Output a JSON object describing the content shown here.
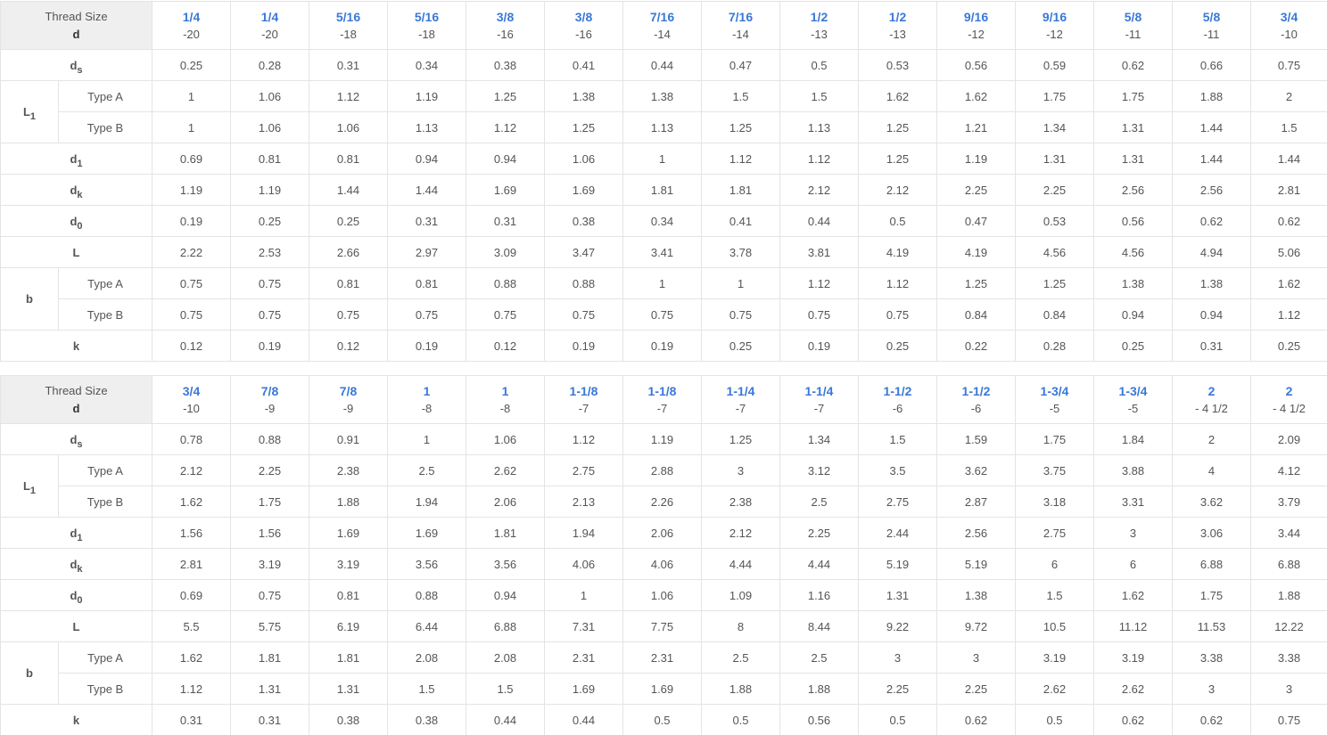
{
  "tables": [
    {
      "header": {
        "corner_line1": "Thread Size",
        "corner_line2": "d",
        "sizes": [
          "1/4",
          "1/4",
          "5/16",
          "5/16",
          "3/8",
          "3/8",
          "7/16",
          "7/16",
          "1/2",
          "1/2",
          "9/16",
          "9/16",
          "5/8",
          "5/8",
          "3/4"
        ],
        "pitches": [
          "-20",
          "-20",
          "-18",
          "-18",
          "-16",
          "-16",
          "-14",
          "-14",
          "-13",
          "-13",
          "-12",
          "-12",
          "-11",
          "-11",
          "-10"
        ]
      },
      "rows": [
        {
          "group": "d",
          "group_sub": "s",
          "values": [
            "0.25",
            "0.28",
            "0.31",
            "0.34",
            "0.38",
            "0.41",
            "0.44",
            "0.47",
            "0.5",
            "0.53",
            "0.56",
            "0.59",
            "0.62",
            "0.66",
            "0.75"
          ]
        },
        {
          "group": "L",
          "group_sub": "1",
          "type": "Type A",
          "values": [
            "1",
            "1.06",
            "1.12",
            "1.19",
            "1.25",
            "1.38",
            "1.38",
            "1.5",
            "1.5",
            "1.62",
            "1.62",
            "1.75",
            "1.75",
            "1.88",
            "2"
          ]
        },
        {
          "type": "Type B",
          "values": [
            "1",
            "1.06",
            "1.06",
            "1.13",
            "1.12",
            "1.25",
            "1.13",
            "1.25",
            "1.13",
            "1.25",
            "1.21",
            "1.34",
            "1.31",
            "1.44",
            "1.5"
          ]
        },
        {
          "group": "d",
          "group_sub": "1",
          "values": [
            "0.69",
            "0.81",
            "0.81",
            "0.94",
            "0.94",
            "1.06",
            "1",
            "1.12",
            "1.12",
            "1.25",
            "1.19",
            "1.31",
            "1.31",
            "1.44",
            "1.44"
          ]
        },
        {
          "group": "d",
          "group_sub": "k",
          "values": [
            "1.19",
            "1.19",
            "1.44",
            "1.44",
            "1.69",
            "1.69",
            "1.81",
            "1.81",
            "2.12",
            "2.12",
            "2.25",
            "2.25",
            "2.56",
            "2.56",
            "2.81"
          ]
        },
        {
          "group": "d",
          "group_sub": "0",
          "values": [
            "0.19",
            "0.25",
            "0.25",
            "0.31",
            "0.31",
            "0.38",
            "0.34",
            "0.41",
            "0.44",
            "0.5",
            "0.47",
            "0.53",
            "0.56",
            "0.62",
            "0.62"
          ]
        },
        {
          "group": "L",
          "group_sub": "",
          "values": [
            "2.22",
            "2.53",
            "2.66",
            "2.97",
            "3.09",
            "3.47",
            "3.41",
            "3.78",
            "3.81",
            "4.19",
            "4.19",
            "4.56",
            "4.56",
            "4.94",
            "5.06"
          ]
        },
        {
          "group": "b",
          "group_sub": "",
          "type": "Type A",
          "values": [
            "0.75",
            "0.75",
            "0.81",
            "0.81",
            "0.88",
            "0.88",
            "1",
            "1",
            "1.12",
            "1.12",
            "1.25",
            "1.25",
            "1.38",
            "1.38",
            "1.62"
          ]
        },
        {
          "type": "Type B",
          "values": [
            "0.75",
            "0.75",
            "0.75",
            "0.75",
            "0.75",
            "0.75",
            "0.75",
            "0.75",
            "0.75",
            "0.75",
            "0.84",
            "0.84",
            "0.94",
            "0.94",
            "1.12"
          ]
        },
        {
          "group": "k",
          "group_sub": "",
          "values": [
            "0.12",
            "0.19",
            "0.12",
            "0.19",
            "0.12",
            "0.19",
            "0.19",
            "0.25",
            "0.19",
            "0.25",
            "0.22",
            "0.28",
            "0.25",
            "0.31",
            "0.25"
          ]
        }
      ]
    },
    {
      "header": {
        "corner_line1": "Thread Size",
        "corner_line2": "d",
        "sizes": [
          "3/4",
          "7/8",
          "7/8",
          "1",
          "1",
          "1-1/8",
          "1-1/8",
          "1-1/4",
          "1-1/4",
          "1-1/2",
          "1-1/2",
          "1-3/4",
          "1-3/4",
          "2",
          "2"
        ],
        "pitches": [
          "-10",
          "-9",
          "-9",
          "-8",
          "-8",
          "-7",
          "-7",
          "-7",
          "-7",
          "-6",
          "-6",
          "-5",
          "-5",
          "- 4 1/2",
          "- 4 1/2"
        ]
      },
      "rows": [
        {
          "group": "d",
          "group_sub": "s",
          "values": [
            "0.78",
            "0.88",
            "0.91",
            "1",
            "1.06",
            "1.12",
            "1.19",
            "1.25",
            "1.34",
            "1.5",
            "1.59",
            "1.75",
            "1.84",
            "2",
            "2.09"
          ]
        },
        {
          "group": "L",
          "group_sub": "1",
          "type": "Type A",
          "values": [
            "2.12",
            "2.25",
            "2.38",
            "2.5",
            "2.62",
            "2.75",
            "2.88",
            "3",
            "3.12",
            "3.5",
            "3.62",
            "3.75",
            "3.88",
            "4",
            "4.12"
          ]
        },
        {
          "type": "Type B",
          "values": [
            "1.62",
            "1.75",
            "1.88",
            "1.94",
            "2.06",
            "2.13",
            "2.26",
            "2.38",
            "2.5",
            "2.75",
            "2.87",
            "3.18",
            "3.31",
            "3.62",
            "3.79"
          ]
        },
        {
          "group": "d",
          "group_sub": "1",
          "values": [
            "1.56",
            "1.56",
            "1.69",
            "1.69",
            "1.81",
            "1.94",
            "2.06",
            "2.12",
            "2.25",
            "2.44",
            "2.56",
            "2.75",
            "3",
            "3.06",
            "3.44"
          ]
        },
        {
          "group": "d",
          "group_sub": "k",
          "values": [
            "2.81",
            "3.19",
            "3.19",
            "3.56",
            "3.56",
            "4.06",
            "4.06",
            "4.44",
            "4.44",
            "5.19",
            "5.19",
            "6",
            "6",
            "6.88",
            "6.88"
          ]
        },
        {
          "group": "d",
          "group_sub": "0",
          "values": [
            "0.69",
            "0.75",
            "0.81",
            "0.88",
            "0.94",
            "1",
            "1.06",
            "1.09",
            "1.16",
            "1.31",
            "1.38",
            "1.5",
            "1.62",
            "1.75",
            "1.88"
          ]
        },
        {
          "group": "L",
          "group_sub": "",
          "values": [
            "5.5",
            "5.75",
            "6.19",
            "6.44",
            "6.88",
            "7.31",
            "7.75",
            "8",
            "8.44",
            "9.22",
            "9.72",
            "10.5",
            "11.12",
            "11.53",
            "12.22"
          ]
        },
        {
          "group": "b",
          "group_sub": "",
          "type": "Type A",
          "values": [
            "1.62",
            "1.81",
            "1.81",
            "2.08",
            "2.08",
            "2.31",
            "2.31",
            "2.5",
            "2.5",
            "3",
            "3",
            "3.19",
            "3.19",
            "3.38",
            "3.38"
          ]
        },
        {
          "type": "Type B",
          "values": [
            "1.12",
            "1.31",
            "1.31",
            "1.5",
            "1.5",
            "1.69",
            "1.69",
            "1.88",
            "1.88",
            "2.25",
            "2.25",
            "2.62",
            "2.62",
            "3",
            "3"
          ]
        },
        {
          "group": "k",
          "group_sub": "",
          "values": [
            "0.31",
            "0.31",
            "0.38",
            "0.38",
            "0.44",
            "0.44",
            "0.5",
            "0.5",
            "0.56",
            "0.5",
            "0.62",
            "0.5",
            "0.62",
            "0.62",
            "0.75"
          ]
        }
      ]
    }
  ]
}
